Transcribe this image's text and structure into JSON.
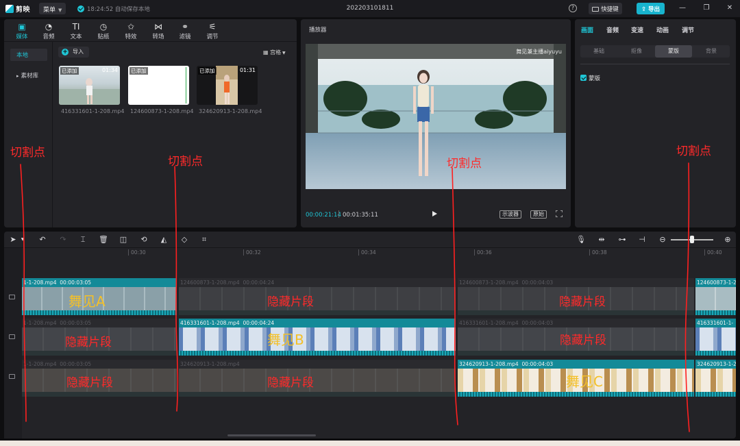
{
  "app": {
    "name": "剪映",
    "menu_label": "菜单",
    "save_status": "18:24:52 自动保存本地",
    "project_title": "202203101811",
    "shortcut_label": "快捷键",
    "export_label": "导出",
    "accent": "#1fc6d6"
  },
  "media": {
    "tabs": [
      {
        "label": "媒体",
        "icon": "media-icon"
      },
      {
        "label": "音频",
        "icon": "audio-icon"
      },
      {
        "label": "文本",
        "icon": "text-icon"
      },
      {
        "label": "贴纸",
        "icon": "sticker-icon"
      },
      {
        "label": "特效",
        "icon": "effect-icon"
      },
      {
        "label": "转场",
        "icon": "transition-icon"
      },
      {
        "label": "滤镜",
        "icon": "filter-icon"
      },
      {
        "label": "调节",
        "icon": "adjust-icon"
      }
    ],
    "side": {
      "local": "本地",
      "library": "素材库"
    },
    "import_label": "导入",
    "view_label": "宫格",
    "clips": [
      {
        "added": "已添加",
        "duration": "01:34",
        "name": "416331601-1-208.mp4"
      },
      {
        "added": "已添加",
        "duration": "",
        "name": "124600873-1-208.mp4"
      },
      {
        "added": "已添加",
        "duration": "01:31",
        "name": "324620913-1-208.mp4"
      }
    ]
  },
  "player": {
    "title": "播放器",
    "watermark": "舞见兼主播aiyuyu",
    "current_time": "00:00:21:14",
    "total_time": "00:01:35:11",
    "scope_label": "示波器",
    "original_label": "原始"
  },
  "props": {
    "tabs": [
      "画面",
      "音频",
      "变速",
      "动画",
      "调节"
    ],
    "subtabs": [
      "基础",
      "抠像",
      "蒙版",
      "背景"
    ],
    "mask_label": "蒙版"
  },
  "timeline": {
    "ticks": [
      "00:30",
      "00:32",
      "00:34",
      "00:36",
      "00:38",
      "00:40"
    ],
    "tracks": [
      {
        "segments": [
          {
            "name": "416331601-1-208.mp4",
            "duration": "00:00:03:05",
            "visible": true,
            "name_partial": "1-1-208.mp4"
          },
          {
            "name": "124600873-1-208.mp4",
            "duration": "00:00:04:24",
            "visible": false
          },
          {
            "name": "124600873-1-208.mp4",
            "duration": "00:00:04:03",
            "visible": false
          },
          {
            "name": "124600873-1-20",
            "duration": "",
            "visible": true
          }
        ]
      },
      {
        "segments": [
          {
            "name": "1-1-208.mp4",
            "duration": "00:00:03:05",
            "visible": false
          },
          {
            "name": "416331601-1-208.mp4",
            "duration": "00:00:04:24",
            "visible": true
          },
          {
            "name": "416331601-1-208.mp4",
            "duration": "00:00:04:03",
            "visible": false
          },
          {
            "name": "416331601-1-",
            "duration": "",
            "visible": true
          }
        ]
      },
      {
        "segments": [
          {
            "name": "1-1-208.mp4",
            "duration": "00:00:03:05",
            "visible": false
          },
          {
            "name": "324620913-1-208.mp4",
            "duration": "",
            "visible": false
          },
          {
            "name": "324620913-1-208.mp4",
            "duration": "00:00:04:03",
            "visible": true
          },
          {
            "name": "324620913-1-2",
            "duration": "",
            "visible": true
          }
        ]
      }
    ]
  },
  "annotations": {
    "cut_point": "切割点",
    "hidden_segment": "隐藏片段",
    "dance_a": "舞见A",
    "dance_b": "舞见B",
    "dance_c": "舞见C"
  }
}
